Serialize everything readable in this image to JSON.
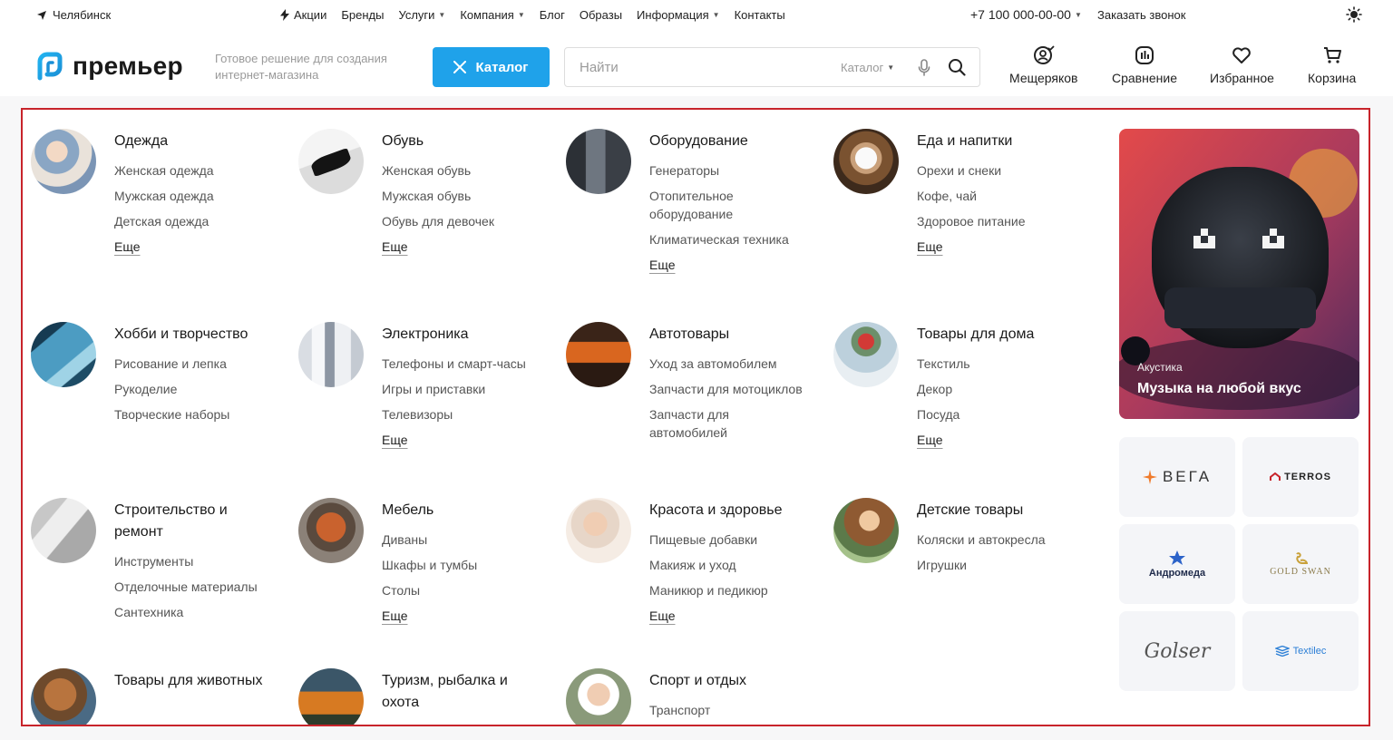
{
  "topbar": {
    "city": "Челябинск",
    "nav": [
      {
        "label": "Акции",
        "icon": "bolt-icon"
      },
      {
        "label": "Бренды"
      },
      {
        "label": "Услуги",
        "dropdown": true
      },
      {
        "label": "Компания",
        "dropdown": true
      },
      {
        "label": "Блог"
      },
      {
        "label": "Образы"
      },
      {
        "label": "Информация",
        "dropdown": true
      },
      {
        "label": "Контакты"
      }
    ],
    "phone": "+7 100 000-00-00",
    "callback": "Заказать звонок"
  },
  "header": {
    "logo": "премьер",
    "tagline": "Готовое решение для создания интернет-магазина",
    "catalog_label": "Каталог",
    "search_placeholder": "Найти",
    "search_scope": "Каталог",
    "actions": [
      {
        "label": "Мещеряков",
        "icon": "user-icon"
      },
      {
        "label": "Сравнение",
        "icon": "compare-icon"
      },
      {
        "label": "Избранное",
        "icon": "heart-icon"
      },
      {
        "label": "Корзина",
        "icon": "cart-icon"
      }
    ]
  },
  "colors": {
    "accent": "#1fa2ea",
    "highlight_border": "#c8242b"
  },
  "catalog": {
    "more_label": "Еще",
    "categories": [
      {
        "title": "Одежда",
        "items": [
          "Женская одежда",
          "Мужская одежда",
          "Детская одежда"
        ],
        "more": true
      },
      {
        "title": "Обувь",
        "items": [
          "Женская обувь",
          "Мужская обувь",
          "Обувь для девочек"
        ],
        "more": true
      },
      {
        "title": "Оборудование",
        "items": [
          "Генераторы",
          "Отопительное оборудование",
          "Климатическая техника"
        ],
        "more": true
      },
      {
        "title": "Еда и напитки",
        "items": [
          "Орехи и снеки",
          "Кофе, чай",
          "Здоровое питание"
        ],
        "more": true
      },
      {
        "title": "Хобби и творчество",
        "items": [
          "Рисование и лепка",
          "Рукоделие",
          "Творческие наборы"
        ],
        "more": false
      },
      {
        "title": "Электроника",
        "items": [
          "Телефоны и смарт-часы",
          "Игры и приставки",
          "Телевизоры"
        ],
        "more": true
      },
      {
        "title": "Автотовары",
        "items": [
          "Уход за автомобилем",
          "Запчасти для мотоциклов",
          "Запчасти для автомобилей"
        ],
        "more": false
      },
      {
        "title": "Товары для дома",
        "items": [
          "Текстиль",
          "Декор",
          "Посуда"
        ],
        "more": true
      },
      {
        "title": "Строительство и ремонт",
        "items": [
          "Инструменты",
          "Отделочные материалы",
          "Сантехника"
        ],
        "more": false
      },
      {
        "title": "Мебель",
        "items": [
          "Диваны",
          "Шкафы и тумбы",
          "Столы"
        ],
        "more": true
      },
      {
        "title": "Красота и здоровье",
        "items": [
          "Пищевые добавки",
          "Макияж и уход",
          "Маникюр и педикюр"
        ],
        "more": true
      },
      {
        "title": "Детские товары",
        "items": [
          "Коляски и автокресла",
          "Игрушки"
        ],
        "more": false
      },
      {
        "title": "Товары для животных",
        "items": [],
        "more": false
      },
      {
        "title": "Туризм, рыбалка и охота",
        "items": [],
        "more": false
      },
      {
        "title": "Спорт и отдых",
        "items": [
          "Транспорт"
        ],
        "more": false
      }
    ]
  },
  "promo": {
    "label": "Акустика",
    "title": "Музыка на любой вкус"
  },
  "brands": [
    "ВЕГА",
    "TERROS",
    "Андромеда",
    "GOLD SWAN",
    "Golser",
    "Textilec"
  ]
}
